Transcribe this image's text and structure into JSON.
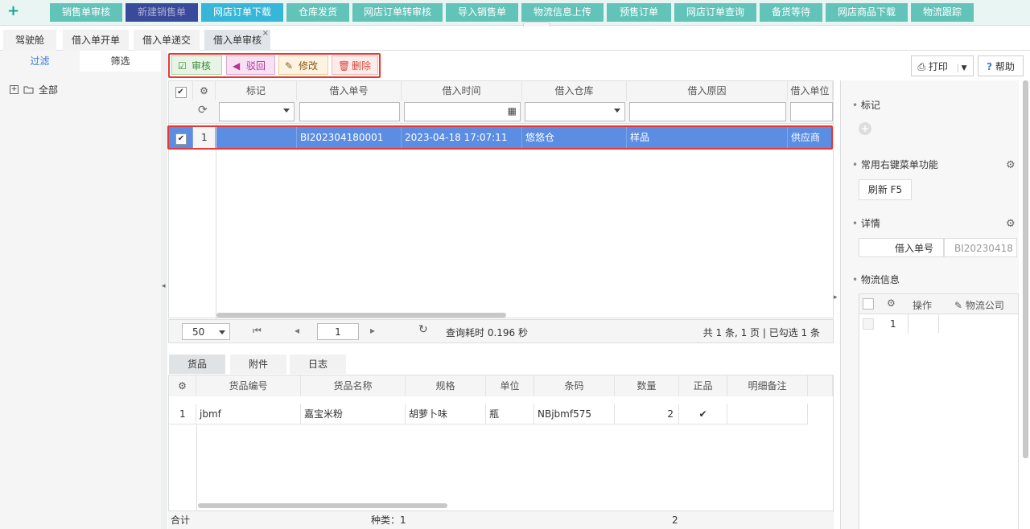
{
  "topnav": {
    "items": [
      "销售单审核",
      "新建销售单",
      "网店订单下载",
      "仓库发货",
      "网店订单转审核",
      "导入销售单",
      "物流信息上传",
      "预售订单",
      "网店订单查询",
      "备货等待",
      "网店商品下载",
      "物流跟踪"
    ]
  },
  "tabs": {
    "items": [
      "驾驶舱",
      "借入单开单",
      "借入单递交",
      "借入单审核"
    ],
    "close": "×"
  },
  "left": {
    "tab_filter": "过滤",
    "tab_select": "筛选",
    "tree_root": "全部"
  },
  "toolbar": {
    "audit": "审核",
    "reject": "驳回",
    "edit": "修改",
    "delete": "删除",
    "print": "打印",
    "help": "帮助"
  },
  "grid": {
    "headers": [
      "标记",
      "借入单号",
      "借入时间",
      "借入仓库",
      "借入原因",
      "借入单位"
    ],
    "row": {
      "index": "1",
      "mark": "",
      "order_no": "BI202304180001",
      "time": "2023-04-18 17:07:11",
      "warehouse": "悠悠仓",
      "reason": "样品",
      "unit": "供应商"
    }
  },
  "pager": {
    "page_size": "50",
    "page": "1",
    "timing": "查询耗时 0.196 秒",
    "summary": "共 1 条, 1 页 | 已勾选 1 条"
  },
  "detail_tabs": [
    "货品",
    "附件",
    "日志"
  ],
  "detail": {
    "headers": [
      "货品编号",
      "货品名称",
      "规格",
      "单位",
      "条码",
      "数量",
      "正品",
      "明细备注"
    ],
    "row": {
      "index": "1",
      "code": "jbmf",
      "name": "嘉宝米粉",
      "spec": "胡萝卜味",
      "unit": "瓶",
      "barcode": "NBjbmf575",
      "qty": "2",
      "genuine": "✔",
      "note": ""
    }
  },
  "footer": {
    "total_label": "合计",
    "kinds": "种类：1",
    "qty_total": "2"
  },
  "right": {
    "mark_title": "标记",
    "menu_title": "常用右键菜单功能",
    "refresh": "刷新 F5",
    "detail_title": "详情",
    "detail_key": "借入单号",
    "detail_value": "BI20230418",
    "logistics_title": "物流信息",
    "log_headers": [
      "操作",
      "物流公司"
    ],
    "log_row_index": "1"
  },
  "colors": {
    "accent": "#62c3b8",
    "selected_row": "#5b8de2",
    "highlight": "#e53935"
  }
}
